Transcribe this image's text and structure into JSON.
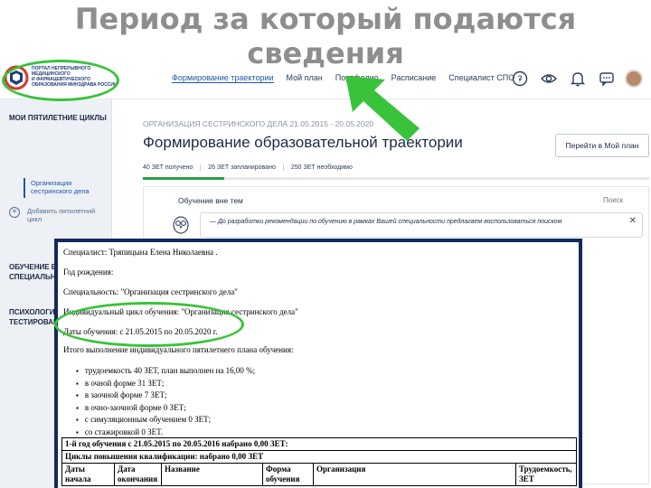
{
  "slide": {
    "title_line1": "Период за который подаются",
    "title_line2": "сведения"
  },
  "header": {
    "logo_lines": [
      "ПОРТАЛ НЕПРЕРЫВНОГО",
      "МЕДИЦИНСКОГО",
      "И ФАРМАЦЕВТИЧЕСКОГО",
      "ОБРАЗОВАНИЯ МИНЗДРАВА РОССИИ"
    ],
    "nav": [
      {
        "label": "Формирование траектории",
        "active": true
      },
      {
        "label": "Мой план",
        "active": false
      },
      {
        "label": "Портфолио",
        "active": false
      },
      {
        "label": "Расписание",
        "active": false
      },
      {
        "label": "Специалист СПО",
        "active": false
      }
    ],
    "icons": [
      "help-icon",
      "eye-icon",
      "bell-icon",
      "chat-icon"
    ]
  },
  "sidebar": {
    "section1": "МОИ ПЯТИЛЕТНИЕ ЦИКЛЫ",
    "cycle_item": "Организация сестринского дела",
    "add_cycle": "Добавить пятилетний цикл",
    "section2": "ОБУЧЕНИЕ ВНЕ МОИХ СПЕЦИАЛЬНОСТЕЙ",
    "section3": "ПСИХОЛОГИЧЕ ТЕСТИРОВАНИ"
  },
  "main": {
    "org": "ОРГАНИЗАЦИЯ СЕСТРИНСКОГО ДЕЛА 21.05.2015 - 20.05.2020",
    "title": "Формирование образовательной траектории",
    "goto_button": "Перейти в Мой план",
    "stats": [
      "40 ЗЕТ получено",
      "26 ЗЕТ запланировано",
      "250 ЗЕТ необходимо"
    ],
    "progress_fraction": 0.16,
    "panel_title": "Обучение вне тем",
    "search_label": "Поиск",
    "notice": "— До разработки рекомендации по обучению в рамках Вашей специальности предлагаем воспользоваться поиском"
  },
  "document": {
    "specialist": "Специалист: Тряпицына Елена Николаевна .",
    "birth_year": "Год рождения:",
    "specialty": "Специальность: \"Организация сестринского дела\"",
    "cycle": "Индивидуальный цикл обучения: \"Организация сестринского дела\"",
    "dates": "Даты обучения: с 21.05.2015 по 20.05.2020 г.",
    "summary": "Итого выполнение индивидуального пятилетнего плана обучения:",
    "bullets": [
      "трудоемкость 40 ЗЕТ, план выполнен на 16,00 %;",
      "в очной форме 31 ЗЕТ;",
      "в заочной форме 7 ЗЕТ;",
      "в очно-заочной форме 0 ЗЕТ;",
      "с симуляционным обучением 0 ЗЕТ;",
      "со стажировкой 0 ЗЕТ."
    ],
    "year_row": "1-й год обучения с 21.05.2015 по 20.05.2016 набрано 0,00 ЗЕТ:",
    "cycles_row": "Циклы повышения квалификации: набрано 0,00 ЗЕТ",
    "columns": [
      "Даты начала",
      "Дата окончания",
      "Название",
      "Форма обучения",
      "Организация",
      "Трудоемкость, ЗЕТ"
    ]
  },
  "colors": {
    "highlight": "#38c33a",
    "doc_border": "#14295c",
    "accent": "#1f57a8"
  }
}
